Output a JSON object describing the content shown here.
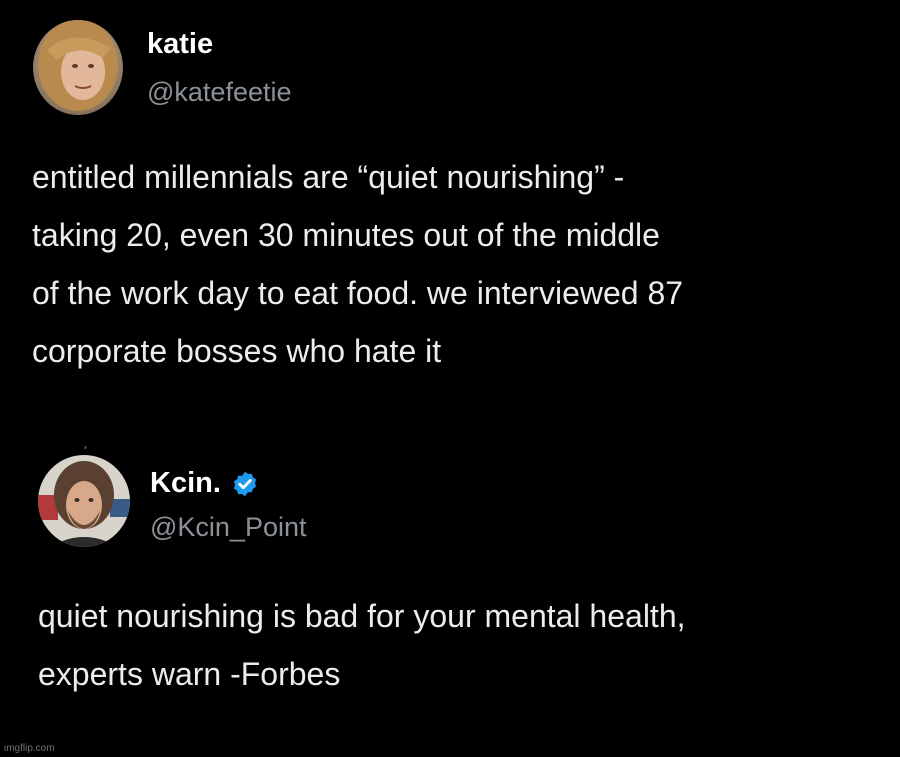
{
  "posts": [
    {
      "author": {
        "name": "katie",
        "handle": "@katefeetie",
        "verified": false
      },
      "text_lines": [
        "entitled millennials are “quiet nourishing” -",
        "taking 20, even 30 minutes out of the middle",
        "of the work day to eat food. we interviewed 87",
        "corporate bosses who hate it"
      ]
    },
    {
      "author": {
        "name": "Kcin.",
        "handle": "@Kcin_Point",
        "verified": true
      },
      "text_lines": [
        "quiet nourishing is bad for your mental health,",
        "experts warn -Forbes"
      ]
    }
  ],
  "watermark": "imgflip.com",
  "colors": {
    "background": "#000000",
    "text": "#ececec",
    "handle": "#8b9197",
    "verified": "#1d9bf0"
  }
}
